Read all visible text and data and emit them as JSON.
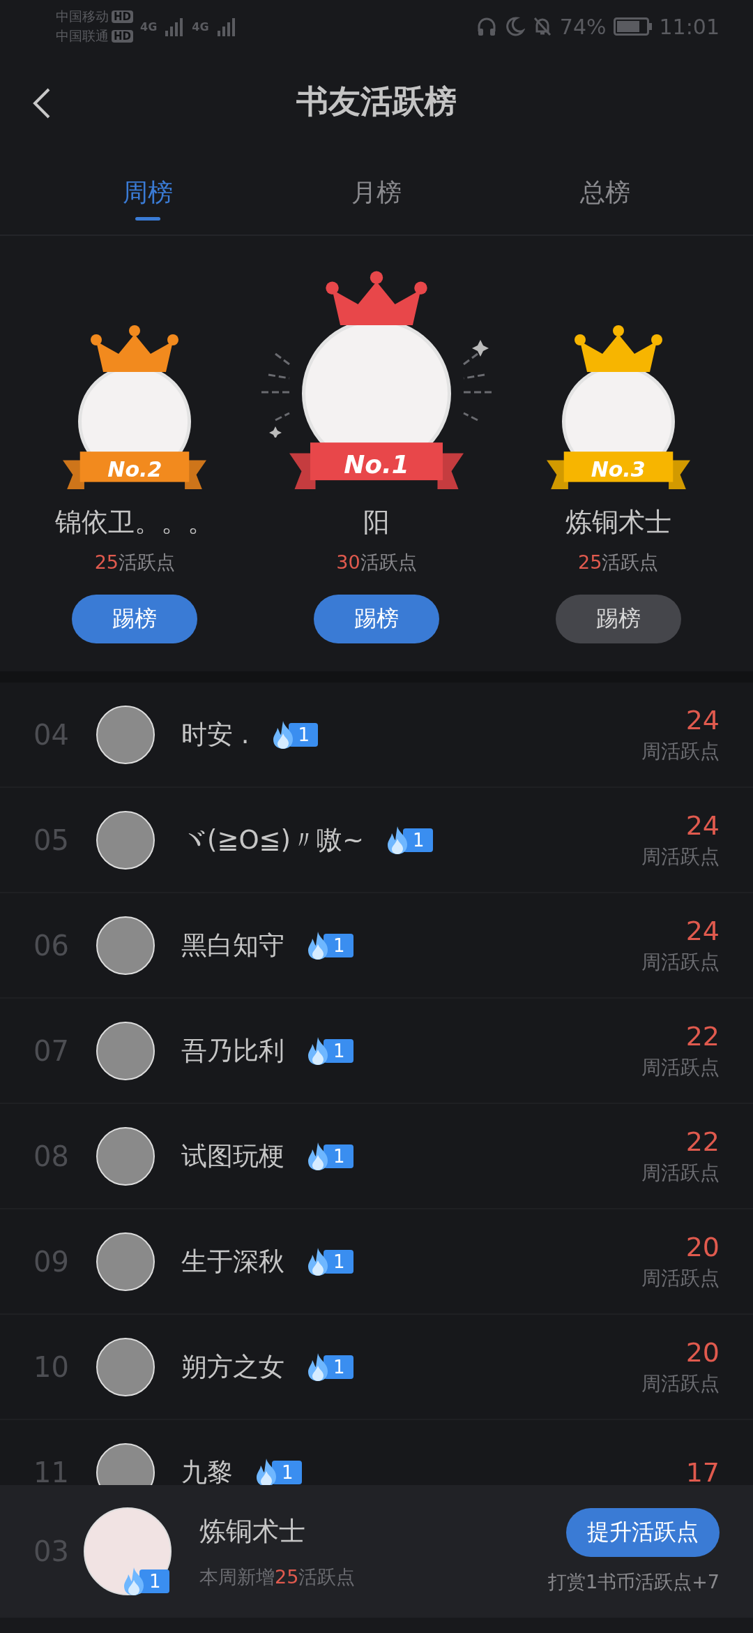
{
  "status_bar": {
    "carriers": [
      "中国移动",
      "中国联通"
    ],
    "hd_badges": [
      "HD",
      "HD"
    ],
    "network": [
      "4G",
      "4G"
    ],
    "battery_percent": "74%",
    "time": "11:01"
  },
  "header": {
    "title": "书友活跃榜"
  },
  "tabs": [
    {
      "label": "周榜",
      "selected": true
    },
    {
      "label": "月榜",
      "selected": false
    },
    {
      "label": "总榜",
      "selected": false
    }
  ],
  "podium": [
    {
      "rank_label": "No.2",
      "kind": "runner",
      "color": "#f28a1e",
      "name": "锦依卫。。。",
      "points": "25",
      "points_unit": "活跃点",
      "button": "踢榜",
      "disabled": false
    },
    {
      "rank_label": "No.1",
      "kind": "champion",
      "color": "#e8474a",
      "name": "阳",
      "points": "30",
      "points_unit": "活跃点",
      "button": "踢榜",
      "disabled": false
    },
    {
      "rank_label": "No.3",
      "kind": "runner",
      "color": "#f7b500",
      "name": "炼铜术士",
      "points": "25",
      "points_unit": "活跃点",
      "button": "踢榜",
      "disabled": true
    }
  ],
  "rows": [
    {
      "rank": "04",
      "name": "时安 .",
      "badge": "1",
      "score": "24",
      "score_label": "周活跃点"
    },
    {
      "rank": "05",
      "name": "ヾ(≧O≦)〃嗷~",
      "badge": "1",
      "score": "24",
      "score_label": "周活跃点"
    },
    {
      "rank": "06",
      "name": "黑白知守",
      "badge": "1",
      "score": "24",
      "score_label": "周活跃点"
    },
    {
      "rank": "07",
      "name": "吾乃比利",
      "badge": "1",
      "score": "22",
      "score_label": "周活跃点"
    },
    {
      "rank": "08",
      "name": "试图玩梗",
      "badge": "1",
      "score": "22",
      "score_label": "周活跃点"
    },
    {
      "rank": "09",
      "name": "生于深秋",
      "badge": "1",
      "score": "20",
      "score_label": "周活跃点"
    },
    {
      "rank": "10",
      "name": "朔方之女",
      "badge": "1",
      "score": "20",
      "score_label": "周活跃点"
    },
    {
      "rank": "11",
      "name": "九黎",
      "badge": "1",
      "score": "17"
    }
  ],
  "my_rank": {
    "rank": "03",
    "name": "炼铜术士",
    "badge": "1",
    "gain_prefix": "本周新增",
    "gain_value": "25",
    "gain_suffix": "活跃点",
    "button": "提升活跃点",
    "hint": "打赏1书币活跃点+7"
  }
}
